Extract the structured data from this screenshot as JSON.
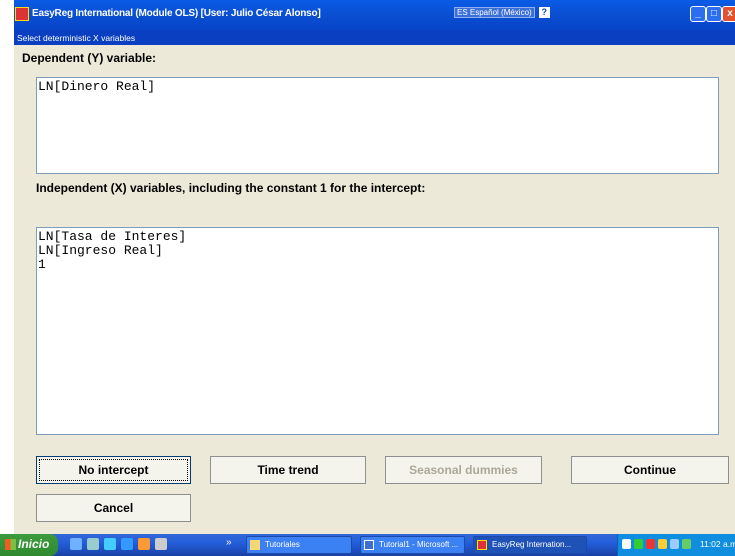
{
  "window": {
    "title": "EasyReg International (Module OLS) [User: Julio César Alonso]",
    "language_indicator": "ES Español (México)",
    "help_label": "?",
    "minimize_glyph": "_",
    "maximize_glyph": "□",
    "close_glyph": "x"
  },
  "dialog": {
    "title": "Select deterministic X variables",
    "dependent_label": "Dependent (Y) variable:",
    "dependent_vars": [
      "LN[Dinero Real]"
    ],
    "independent_label": "Independent (X) variables, including the constant 1 for the intercept:",
    "independent_vars": [
      "LN[Tasa de Interes]",
      "LN[Ingreso Real]",
      "1"
    ],
    "buttons": {
      "no_intercept": "No intercept",
      "time_trend": "Time trend",
      "seasonal_dummies": "Seasonal dummies",
      "continue": "Continue",
      "cancel": "Cancel"
    }
  },
  "taskbar": {
    "start_label": "Inicio",
    "chevron": "»",
    "tasks": [
      {
        "label": "Tutoriales",
        "icon": "folder-icon"
      },
      {
        "label": "Tutorial1 - Microsoft ...",
        "icon": "word-icon"
      },
      {
        "label": "EasyReg Internation...",
        "icon": "easyreg-icon",
        "active": true
      }
    ],
    "clock": "11:02 a.m"
  }
}
